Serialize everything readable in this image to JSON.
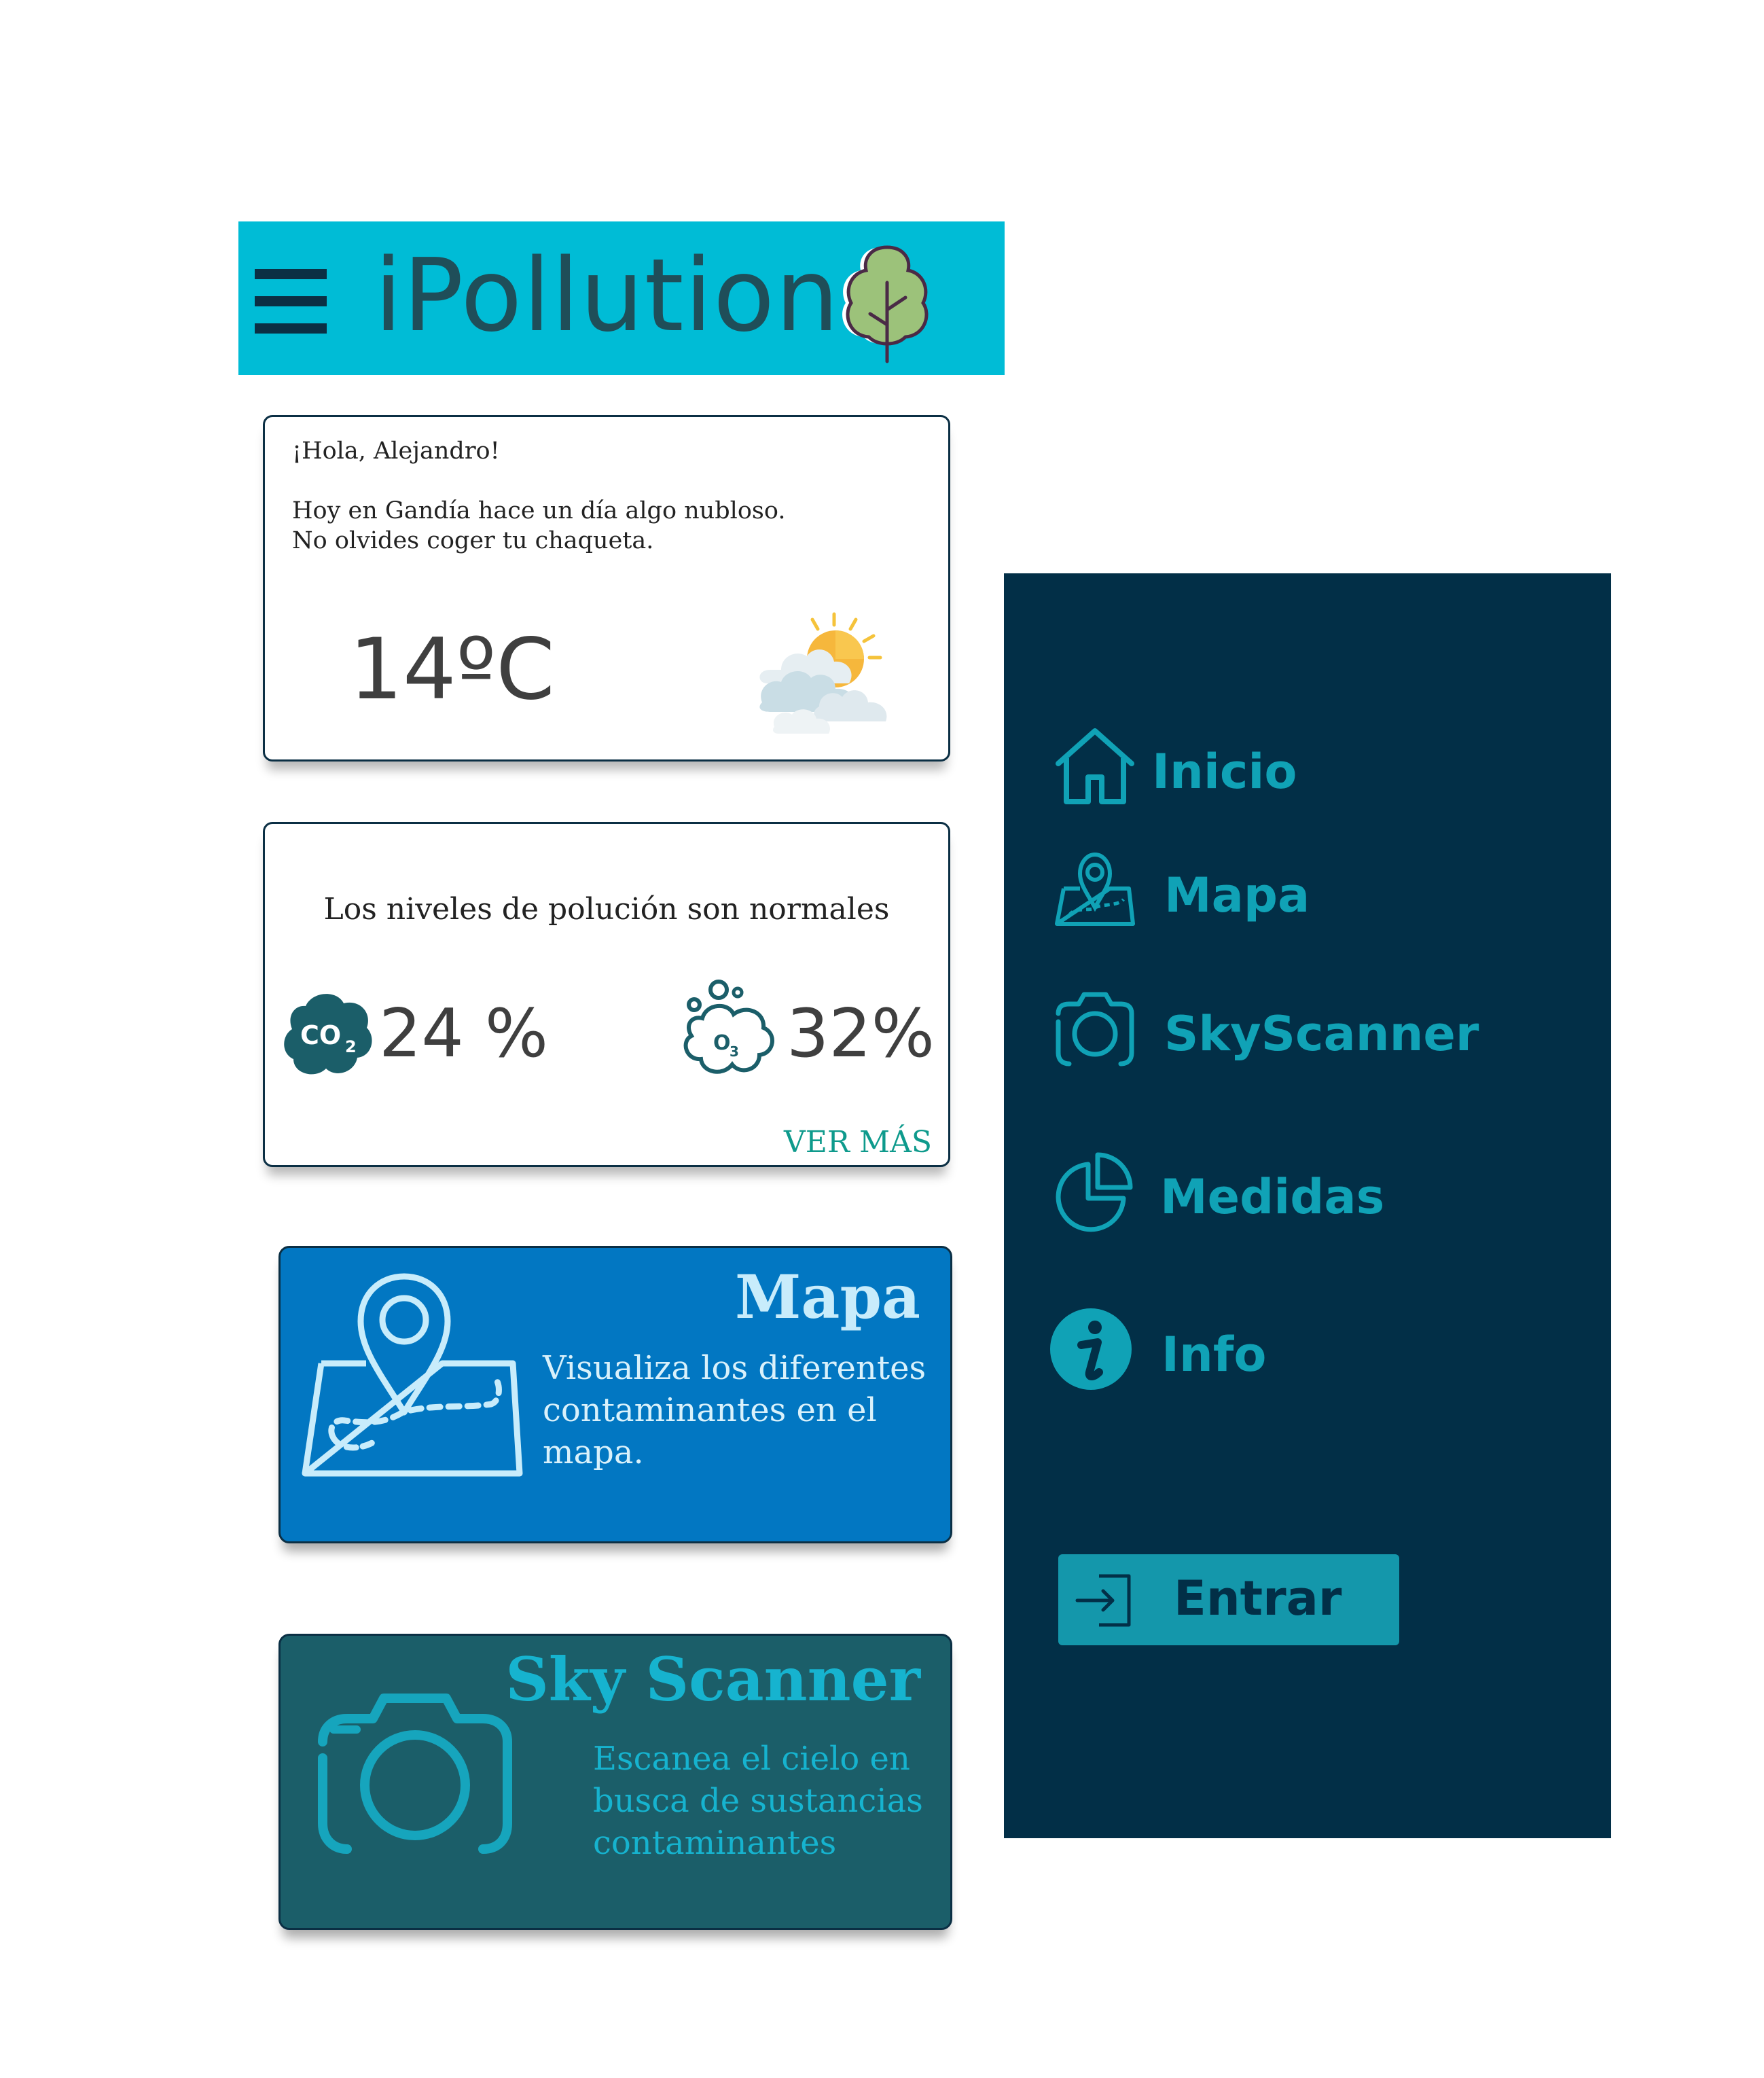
{
  "header": {
    "title": "iPollution",
    "menu_icon": "hamburger-menu-icon",
    "logo_icon": "tree-logo-icon",
    "background_color": "#00bcd6"
  },
  "weather_card": {
    "greeting": "¡Hola, Alejandro!",
    "message_line_1": "Hoy en Gandía hace un día algo nubloso.",
    "message_line_2": "No olvides coger tu chaqueta.",
    "temperature": "14ºC",
    "weather_icon": "partly-cloudy-icon"
  },
  "pollution_card": {
    "title": "Los niveles de polución son normales",
    "co2_label": "CO2",
    "co2_value": "24 %",
    "o3_label": "O3",
    "o3_value": "32%",
    "link": "VER MÁS"
  },
  "features": {
    "mapa": {
      "title": "Mapa",
      "description": "Visualiza los diferentes contaminantes en el mapa.",
      "icon": "map-pin-icon",
      "color": "#0277c2"
    },
    "skyscanner": {
      "title": "Sky Scanner",
      "description": "Escanea el cielo en busca de sustancias contaminantes",
      "icon": "camera-icon",
      "color": "#1b5e69"
    }
  },
  "side_menu": {
    "background_color": "#022f47",
    "items": [
      {
        "label": "Inicio",
        "icon": "home-icon"
      },
      {
        "label": "Mapa",
        "icon": "map-icon"
      },
      {
        "label": "SkyScanner",
        "icon": "camera-icon"
      },
      {
        "label": "Medidas",
        "icon": "pie-chart-icon"
      },
      {
        "label": "Info",
        "icon": "info-icon"
      }
    ],
    "enter_button": {
      "label": "Entrar",
      "icon": "login-icon"
    }
  }
}
